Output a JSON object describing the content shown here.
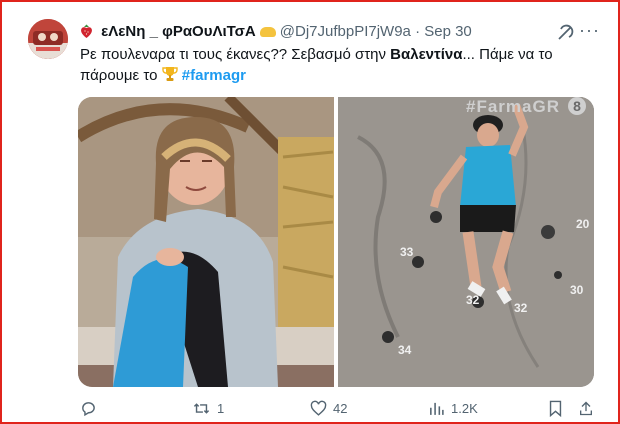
{
  "tweet": {
    "display_name": "εΛεΝη _ φΡαΟυΛιΤσΑ",
    "handle": "@Dj7JufbpPI7jW9a",
    "separator": "·",
    "date": "Sep 30",
    "text_part1": "Ρε πουλεναρα τι τους έκανες?? Σεβασμό στην ",
    "text_bold": "Βαλεντίνα",
    "text_part2": "... Πάμε να το",
    "text_line2": "πάρουμε το ",
    "hashtag": "#farmagr"
  },
  "media": {
    "overlay_text": "#FarmaGR",
    "channel_number": "8",
    "wall_numbers": [
      "33",
      "34",
      "32",
      "20",
      "30",
      "32"
    ]
  },
  "actions": {
    "replies": "",
    "reposts": "1",
    "likes": "42",
    "views": "1.2K"
  },
  "icons": {
    "berry": "strawberry-emoji-icon",
    "hand": "hand-emoji-icon",
    "trophy": "trophy-emoji-icon",
    "grok": "grok-icon",
    "more": "more-icon",
    "reply": "reply-icon",
    "repost": "repost-icon",
    "like": "like-icon",
    "views": "views-icon",
    "bookmark": "bookmark-icon",
    "share": "share-icon"
  }
}
